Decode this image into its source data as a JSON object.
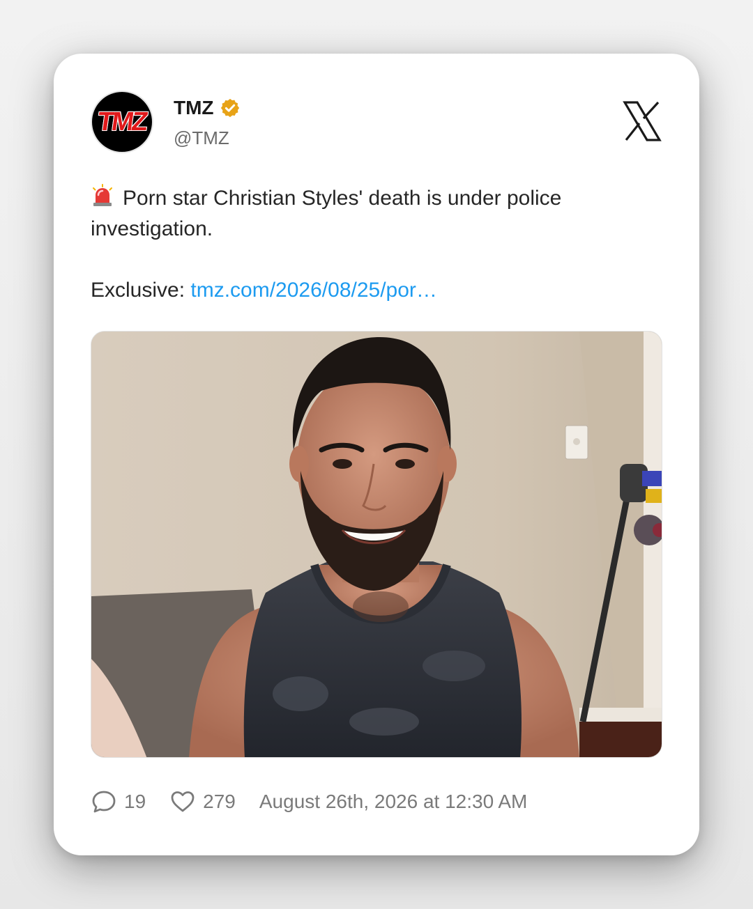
{
  "author": {
    "name": "TMZ",
    "handle": "@TMZ",
    "avatar_text": "TMZ",
    "verified_color": "#e8a317"
  },
  "tweet": {
    "line1": "Porn star Christian Styles' death is under police investigation.",
    "exclusive_label": "Exclusive: ",
    "link_text": "tmz.com/2026/08/25/por…"
  },
  "stats": {
    "replies": "19",
    "likes": "279",
    "timestamp": "August 26th, 2026 at 12:30 AM"
  },
  "icons": {
    "platform": "x-logo-icon",
    "siren": "police-siren-icon",
    "reply": "speech-bubble-icon",
    "like": "heart-icon",
    "verified": "verified-badge-icon"
  },
  "colors": {
    "link": "#1d9bf0",
    "text": "#262626",
    "muted": "#6b6b6b"
  }
}
